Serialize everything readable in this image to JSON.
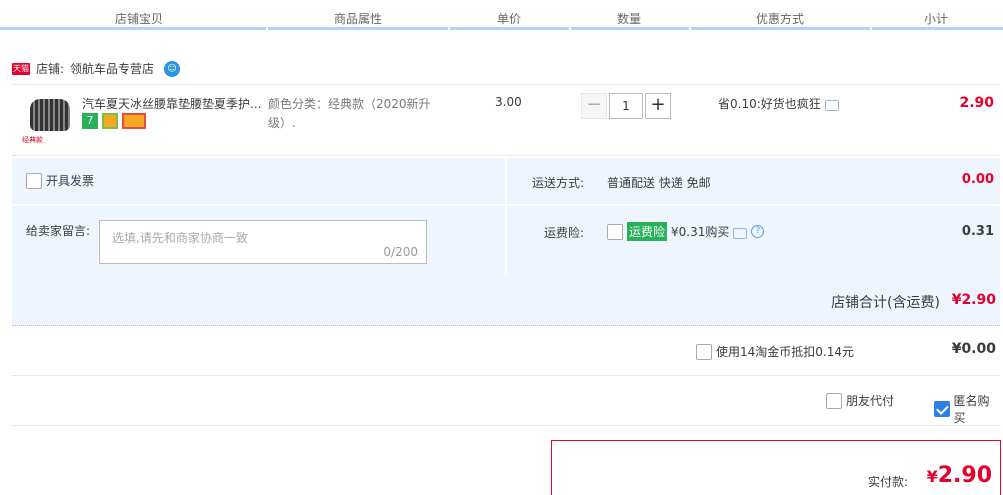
{
  "header": {
    "columns": [
      "店铺宝贝",
      "商品属性",
      "单价",
      "数量",
      "优惠方式",
      "小计"
    ]
  },
  "shop": {
    "badge": "天猫",
    "label": "店铺:",
    "name": "领航车品专营店",
    "chat_icon": "wangwang-chat-icon"
  },
  "item": {
    "title": "汽车夏天冰丝腰靠垫腰垫夏季护...",
    "thumb_tag": "经典款",
    "badge_1": "7",
    "attr": "颜色分类：经典款（2020新升级）.",
    "price": "3.00",
    "qty_minus": "−",
    "qty": "1",
    "qty_plus": "+",
    "promo": "省0.10:好货也疯狂",
    "subtotal": "2.90"
  },
  "extras": {
    "invoice_label": "开具发票",
    "shipping_label": "运送方式:",
    "shipping_value": "普通配送 快递 免邮",
    "shipping_fee": "0.00",
    "note_label": "给卖家留言:",
    "note_placeholder": "选填,请先和商家协商一致",
    "note_count": "0/200",
    "insurance_label": "运费险:",
    "insurance_tag": "运费险",
    "insurance_text": "¥0.31购买",
    "insurance_help": "?",
    "insurance_fee": "0.31"
  },
  "shop_total": {
    "label": "店铺合计(含运费)",
    "amount": "¥2.90"
  },
  "coins": {
    "label": "使用14淘金币抵扣0.14元",
    "amount": "¥0.00"
  },
  "options": {
    "friend_pay": "朋友代付",
    "anonymous": "匿名购买",
    "anonymous_checked": true
  },
  "payment": {
    "label": "实付款:",
    "currency": "¥",
    "amount": "2.90"
  },
  "colors": {
    "accent_red": "#e4002b",
    "header_line": "#b2d1ff",
    "panel_bg": "#eef5ff",
    "green_tag": "#27b258"
  }
}
